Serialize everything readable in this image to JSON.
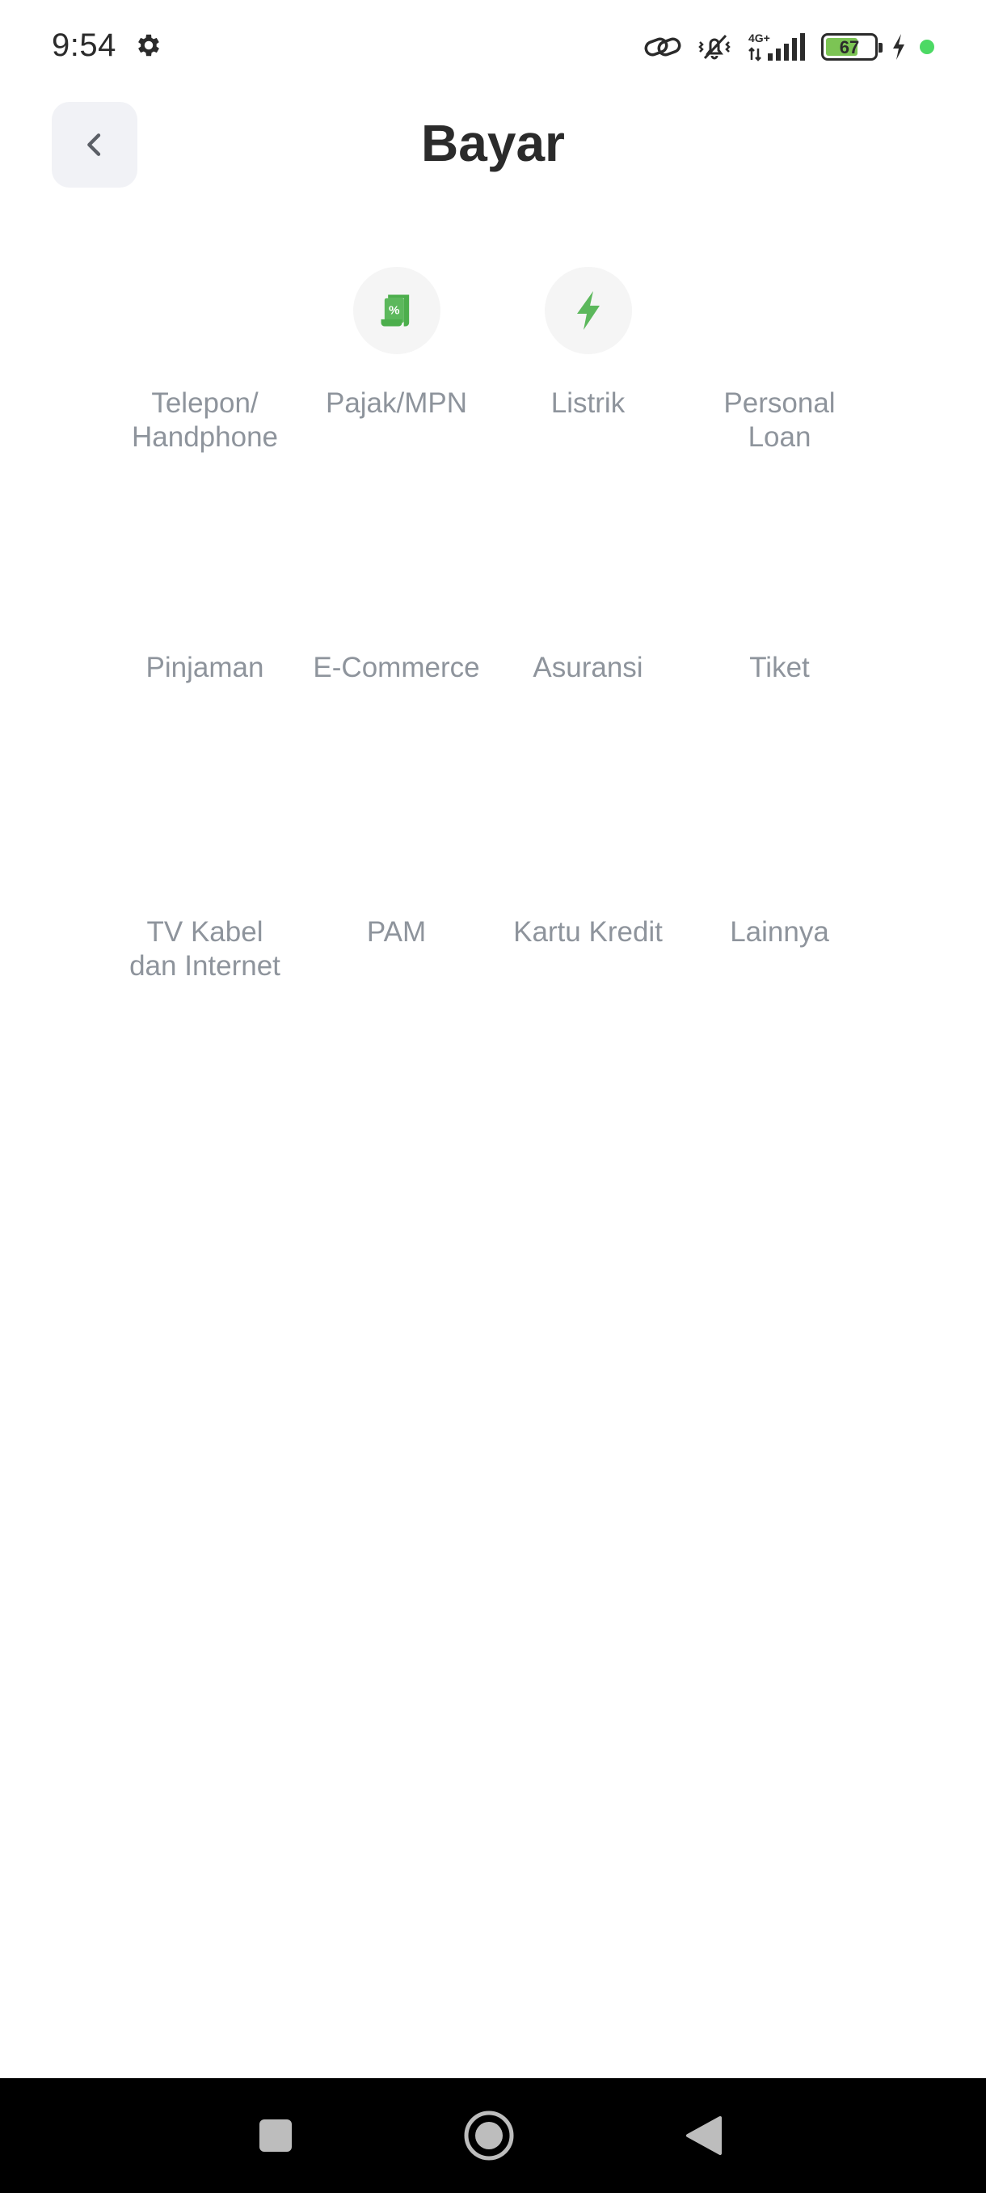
{
  "status_bar": {
    "time": "9:54",
    "network": "4G+",
    "battery_level": 67,
    "battery_text": "67",
    "icons": [
      "gear-icon",
      "link-icon",
      "vibrate-mute-icon",
      "signal-icon",
      "battery-icon",
      "charging-icon",
      "dot-icon"
    ]
  },
  "header": {
    "back_icon": "chevron-left-icon",
    "title": "Bayar"
  },
  "menu": {
    "items": [
      {
        "label": "Telepon/\nHandphone",
        "icon": ""
      },
      {
        "label": "Pajak/MPN",
        "icon": "tax-receipt-icon"
      },
      {
        "label": "Listrik",
        "icon": "lightning-icon"
      },
      {
        "label": "Personal\nLoan",
        "icon": ""
      },
      {
        "label": "Pinjaman",
        "icon": ""
      },
      {
        "label": "E-Commerce",
        "icon": ""
      },
      {
        "label": "Asuransi",
        "icon": ""
      },
      {
        "label": "Tiket",
        "icon": ""
      },
      {
        "label": "TV Kabel\ndan Internet",
        "icon": ""
      },
      {
        "label": "PAM",
        "icon": ""
      },
      {
        "label": "Kartu Kredit",
        "icon": ""
      },
      {
        "label": "Lainnya",
        "icon": ""
      }
    ]
  },
  "nav_bar": {
    "icons": [
      "recents-square-icon",
      "home-circle-icon",
      "back-triangle-icon"
    ]
  },
  "colors": {
    "accent_green": "#5cb85c",
    "label_gray": "#8e949c",
    "title": "#2b2b2b",
    "back_button_bg": "#f1f2f6"
  }
}
